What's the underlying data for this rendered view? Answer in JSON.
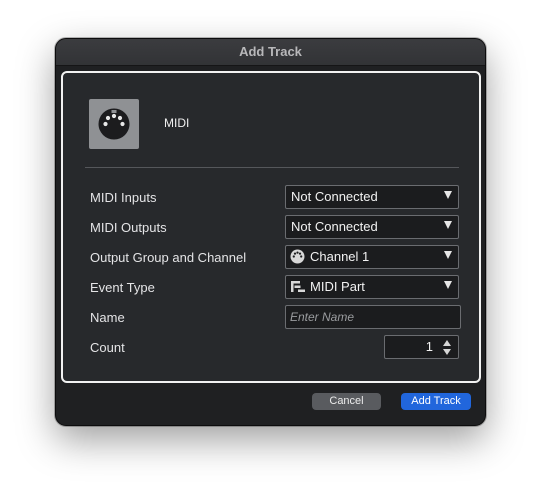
{
  "window": {
    "title": "Add Track"
  },
  "track": {
    "type_label": "MIDI",
    "icon": "midi-connector-icon"
  },
  "fields": {
    "midi_inputs": {
      "label": "MIDI Inputs",
      "value": "Not Connected"
    },
    "midi_outputs": {
      "label": "MIDI Outputs",
      "value": "Not Connected"
    },
    "output_group": {
      "label": "Output Group and Channel",
      "value": "Channel 1",
      "icon": "midi-connector-icon"
    },
    "event_type": {
      "label": "Event Type",
      "value": "MIDI Part",
      "icon": "midi-part-icon"
    },
    "name": {
      "label": "Name",
      "value": "",
      "placeholder": "Enter Name"
    },
    "count": {
      "label": "Count",
      "value": "1"
    }
  },
  "buttons": {
    "cancel": "Cancel",
    "add_track": "Add Track"
  },
  "colors": {
    "window_bg": "#1f2022",
    "panel_bg": "#27292c",
    "panel_border": "#f2f2f2",
    "accent_button": "#2166dc",
    "secondary_button": "#595b5f"
  }
}
